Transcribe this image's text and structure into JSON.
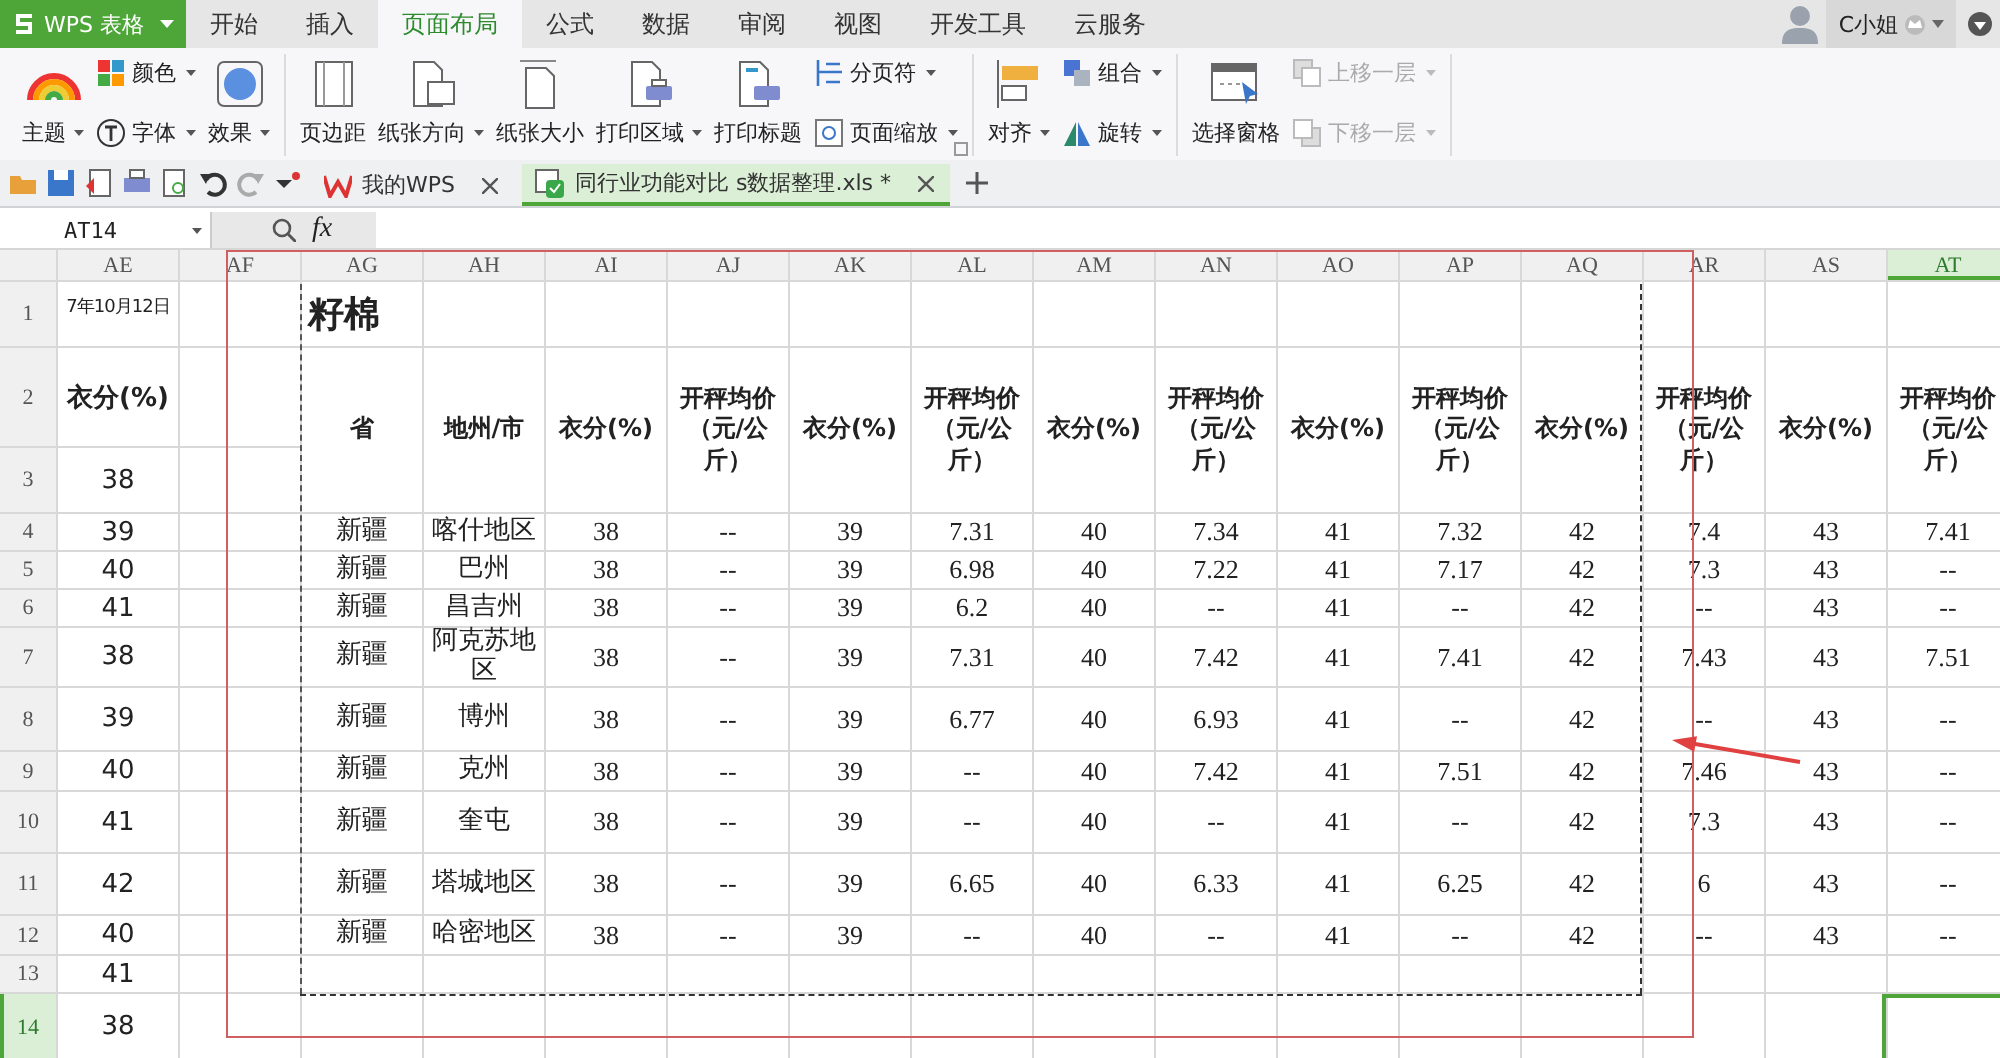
{
  "app": {
    "name": "WPS 表格"
  },
  "menu_tabs": [
    {
      "label": "开始",
      "selected": false
    },
    {
      "label": "插入",
      "selected": false
    },
    {
      "label": "页面布局",
      "selected": true
    },
    {
      "label": "公式",
      "selected": false
    },
    {
      "label": "数据",
      "selected": false
    },
    {
      "label": "审阅",
      "selected": false
    },
    {
      "label": "视图",
      "selected": false
    },
    {
      "label": "开发工具",
      "selected": false
    },
    {
      "label": "云服务",
      "selected": false
    }
  ],
  "user": {
    "name": "C小姐"
  },
  "ribbon": [
    [
      {
        "kind": "large",
        "label": "主题",
        "dropdown": true
      },
      {
        "kind": "stack",
        "items": [
          {
            "label": "颜色",
            "dropdown": true,
            "disabled": false
          },
          {
            "label": "字体",
            "dropdown": true,
            "disabled": false
          }
        ]
      },
      {
        "kind": "large",
        "label": "效果",
        "dropdown": true
      }
    ],
    [
      {
        "kind": "large",
        "label": "页边距",
        "dropdown": false
      },
      {
        "kind": "large",
        "label": "纸张方向",
        "dropdown": true
      },
      {
        "kind": "large",
        "label": "纸张大小",
        "dropdown": false
      },
      {
        "kind": "large",
        "label": "打印区域",
        "dropdown": true
      },
      {
        "kind": "large",
        "label": "打印标题",
        "dropdown": false
      },
      {
        "kind": "stack",
        "items": [
          {
            "label": "分页符",
            "dropdown": true,
            "disabled": false
          },
          {
            "label": "页面缩放",
            "dropdown": true,
            "disabled": false
          }
        ]
      }
    ],
    [
      {
        "kind": "large",
        "label": "对齐",
        "dropdown": true
      },
      {
        "kind": "stack",
        "items": [
          {
            "label": "组合",
            "dropdown": true,
            "disabled": false
          },
          {
            "label": "旋转",
            "dropdown": true,
            "disabled": false
          }
        ]
      }
    ],
    [
      {
        "kind": "large",
        "label": "选择窗格",
        "dropdown": false
      },
      {
        "kind": "stack",
        "items": [
          {
            "label": "上移一层",
            "dropdown": true,
            "disabled": true
          },
          {
            "label": "下移一层",
            "dropdown": true,
            "disabled": true
          }
        ]
      }
    ]
  ],
  "doc_tabs": [
    {
      "label": "我的WPS",
      "selected": false
    },
    {
      "label": "同行业功能对比 s数据整理.xls *",
      "selected": true
    }
  ],
  "formula_bar": {
    "name_box": "AT14",
    "function_label": "fx"
  },
  "sheet": {
    "columns": [
      {
        "label": "AE",
        "selected": false
      },
      {
        "label": "AF",
        "selected": false
      },
      {
        "label": "AG",
        "selected": false
      },
      {
        "label": "AH",
        "selected": false
      },
      {
        "label": "AI",
        "selected": false
      },
      {
        "label": "AJ",
        "selected": false
      },
      {
        "label": "AK",
        "selected": false
      },
      {
        "label": "AL",
        "selected": false
      },
      {
        "label": "AM",
        "selected": false
      },
      {
        "label": "AN",
        "selected": false
      },
      {
        "label": "AO",
        "selected": false
      },
      {
        "label": "AP",
        "selected": false
      },
      {
        "label": "AQ",
        "selected": false
      },
      {
        "label": "AR",
        "selected": false
      },
      {
        "label": "AS",
        "selected": false
      },
      {
        "label": "AT",
        "selected": true
      }
    ],
    "title": "籽棉",
    "header": [
      "省",
      "地州/市",
      "衣分(%)",
      "开秤均价（元/公斤）",
      "衣分(%)",
      "开秤均价（元/公斤）",
      "衣分(%)",
      "开秤均价（元/公斤）",
      "衣分(%)",
      "开秤均价（元/公斤）",
      "衣分(%)",
      "开秤均价（元/公斤）",
      "衣分(%)",
      "开秤均价（元/公斤）"
    ],
    "rows": [
      {
        "label": "1",
        "selected": false,
        "ae": "7年10月12日"
      },
      {
        "label": "2",
        "selected": false,
        "ae": "衣分(%)"
      },
      {
        "label": "3",
        "selected": false,
        "ae": "38"
      },
      {
        "label": "4",
        "selected": false,
        "ae": "39",
        "values": [
          "新疆",
          "喀什地区",
          "38",
          "--",
          "39",
          "7.31",
          "40",
          "7.34",
          "41",
          "7.32",
          "42",
          "7.4",
          "43",
          "7.41"
        ]
      },
      {
        "label": "5",
        "selected": false,
        "ae": "40",
        "values": [
          "新疆",
          "巴州",
          "38",
          "--",
          "39",
          "6.98",
          "40",
          "7.22",
          "41",
          "7.17",
          "42",
          "7.3",
          "43",
          "--"
        ]
      },
      {
        "label": "6",
        "selected": false,
        "ae": "41",
        "values": [
          "新疆",
          "昌吉州",
          "38",
          "--",
          "39",
          "6.2",
          "40",
          "--",
          "41",
          "--",
          "42",
          "--",
          "43",
          "--"
        ]
      },
      {
        "label": "7",
        "selected": false,
        "ae": "38",
        "values": [
          "新疆",
          "阿克苏地区",
          "38",
          "--",
          "39",
          "7.31",
          "40",
          "7.42",
          "41",
          "7.41",
          "42",
          "7.43",
          "43",
          "7.51"
        ]
      },
      {
        "label": "8",
        "selected": false,
        "ae": "39",
        "values": [
          "新疆",
          "博州",
          "38",
          "--",
          "39",
          "6.77",
          "40",
          "6.93",
          "41",
          "--",
          "42",
          "--",
          "43",
          "--"
        ]
      },
      {
        "label": "9",
        "selected": false,
        "ae": "40",
        "values": [
          "新疆",
          "克州",
          "38",
          "--",
          "39",
          "--",
          "40",
          "7.42",
          "41",
          "7.51",
          "42",
          "7.46",
          "43",
          "--"
        ]
      },
      {
        "label": "10",
        "selected": false,
        "ae": "41",
        "values": [
          "新疆",
          "奎屯",
          "38",
          "--",
          "39",
          "--",
          "40",
          "--",
          "41",
          "--",
          "42",
          "7.3",
          "43",
          "--"
        ]
      },
      {
        "label": "11",
        "selected": false,
        "ae": "42",
        "values": [
          "新疆",
          "塔城地区",
          "38",
          "--",
          "39",
          "6.65",
          "40",
          "6.33",
          "41",
          "6.25",
          "42",
          "6",
          "43",
          "--"
        ]
      },
      {
        "label": "12",
        "selected": false,
        "ae": "40",
        "values": [
          "新疆",
          "哈密地区",
          "38",
          "--",
          "39",
          "--",
          "40",
          "--",
          "41",
          "--",
          "42",
          "--",
          "43",
          "--"
        ]
      },
      {
        "label": "13",
        "selected": false,
        "ae": "41"
      },
      {
        "label": "14",
        "selected": true,
        "ae": "38"
      }
    ]
  }
}
